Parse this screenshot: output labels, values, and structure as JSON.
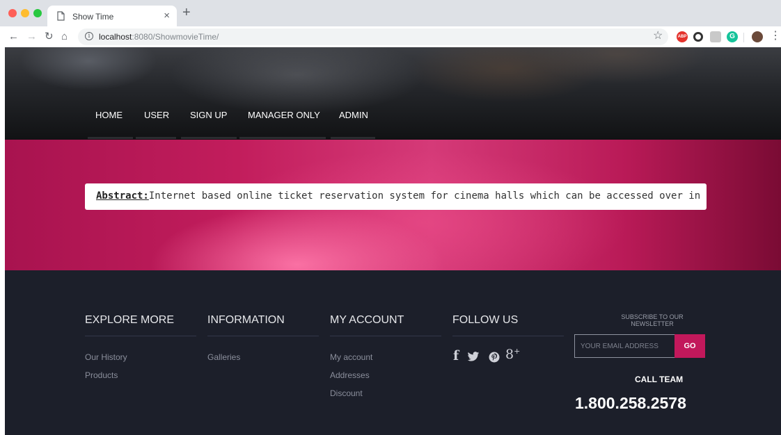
{
  "browser": {
    "tab_title": "Show Time",
    "tab_close": "×",
    "new_tab": "+",
    "url_host": "localhost",
    "url_path": ":8080/ShowmovieTime/"
  },
  "nav": {
    "items": [
      "HOME",
      "USER",
      "SIGN UP",
      "MANAGER ONLY",
      "ADMIN"
    ]
  },
  "abstract": {
    "label": "Abstract:",
    "text": "Internet based online ticket reservation system for cinema halls which can be accessed over in"
  },
  "footer": {
    "columns": [
      {
        "title": "EXPLORE MORE",
        "links": [
          "Our History",
          "Products"
        ]
      },
      {
        "title": "INFORMATION",
        "links": [
          "Galleries"
        ]
      },
      {
        "title": "MY ACCOUNT",
        "links": [
          "My account",
          "Addresses",
          "Discount"
        ]
      },
      {
        "title": "FOLLOW US",
        "links": []
      }
    ],
    "social_icons": [
      "facebook-icon",
      "twitter-icon",
      "pinterest-icon",
      "google-plus-icon"
    ],
    "newsletter_title": "SUBSCRIBE TO OUR NEWSLETTER",
    "email_placeholder": "YOUR EMAIL ADDRESS",
    "go_label": "GO",
    "call_team": "CALL TEAM",
    "phone": "1.800.258.2578"
  },
  "colors": {
    "accent": "#c2185b",
    "footer_bg": "#1c1f2a",
    "banner": "#c21d5c"
  }
}
